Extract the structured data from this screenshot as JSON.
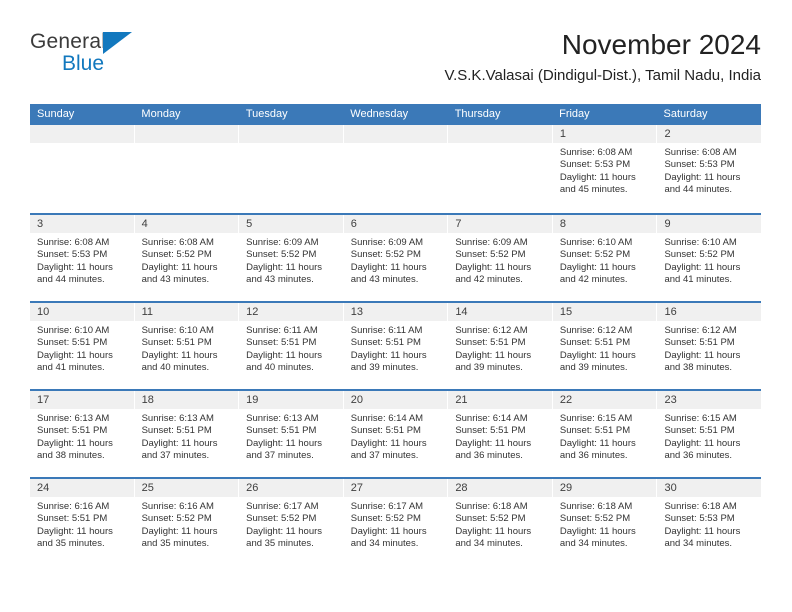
{
  "logo": {
    "word_top": "General",
    "word_bottom": "Blue",
    "triangle_icon": "triangle-icon",
    "blue": "#1278be"
  },
  "header": {
    "month_title": "November 2024",
    "location": "V.S.K.Valasai (Dindigul-Dist.), Tamil Nadu, India"
  },
  "colors": {
    "header_blue": "#3b79b8",
    "cell_header_gray": "#f0f0f0",
    "text": "#333333"
  },
  "weekdays": [
    "Sunday",
    "Monday",
    "Tuesday",
    "Wednesday",
    "Thursday",
    "Friday",
    "Saturday"
  ],
  "labels": {
    "sunrise": "Sunrise:",
    "sunset": "Sunset:",
    "daylight": "Daylight:"
  },
  "weeks": [
    [
      {
        "day": "",
        "empty": true
      },
      {
        "day": "",
        "empty": true
      },
      {
        "day": "",
        "empty": true
      },
      {
        "day": "",
        "empty": true
      },
      {
        "day": "",
        "empty": true
      },
      {
        "day": "1",
        "sunrise": "Sunrise: 6:08 AM",
        "sunset": "Sunset: 5:53 PM",
        "daylight": "Daylight: 11 hours and 45 minutes."
      },
      {
        "day": "2",
        "sunrise": "Sunrise: 6:08 AM",
        "sunset": "Sunset: 5:53 PM",
        "daylight": "Daylight: 11 hours and 44 minutes."
      }
    ],
    [
      {
        "day": "3",
        "sunrise": "Sunrise: 6:08 AM",
        "sunset": "Sunset: 5:53 PM",
        "daylight": "Daylight: 11 hours and 44 minutes."
      },
      {
        "day": "4",
        "sunrise": "Sunrise: 6:08 AM",
        "sunset": "Sunset: 5:52 PM",
        "daylight": "Daylight: 11 hours and 43 minutes."
      },
      {
        "day": "5",
        "sunrise": "Sunrise: 6:09 AM",
        "sunset": "Sunset: 5:52 PM",
        "daylight": "Daylight: 11 hours and 43 minutes."
      },
      {
        "day": "6",
        "sunrise": "Sunrise: 6:09 AM",
        "sunset": "Sunset: 5:52 PM",
        "daylight": "Daylight: 11 hours and 43 minutes."
      },
      {
        "day": "7",
        "sunrise": "Sunrise: 6:09 AM",
        "sunset": "Sunset: 5:52 PM",
        "daylight": "Daylight: 11 hours and 42 minutes."
      },
      {
        "day": "8",
        "sunrise": "Sunrise: 6:10 AM",
        "sunset": "Sunset: 5:52 PM",
        "daylight": "Daylight: 11 hours and 42 minutes."
      },
      {
        "day": "9",
        "sunrise": "Sunrise: 6:10 AM",
        "sunset": "Sunset: 5:52 PM",
        "daylight": "Daylight: 11 hours and 41 minutes."
      }
    ],
    [
      {
        "day": "10",
        "sunrise": "Sunrise: 6:10 AM",
        "sunset": "Sunset: 5:51 PM",
        "daylight": "Daylight: 11 hours and 41 minutes."
      },
      {
        "day": "11",
        "sunrise": "Sunrise: 6:10 AM",
        "sunset": "Sunset: 5:51 PM",
        "daylight": "Daylight: 11 hours and 40 minutes."
      },
      {
        "day": "12",
        "sunrise": "Sunrise: 6:11 AM",
        "sunset": "Sunset: 5:51 PM",
        "daylight": "Daylight: 11 hours and 40 minutes."
      },
      {
        "day": "13",
        "sunrise": "Sunrise: 6:11 AM",
        "sunset": "Sunset: 5:51 PM",
        "daylight": "Daylight: 11 hours and 39 minutes."
      },
      {
        "day": "14",
        "sunrise": "Sunrise: 6:12 AM",
        "sunset": "Sunset: 5:51 PM",
        "daylight": "Daylight: 11 hours and 39 minutes."
      },
      {
        "day": "15",
        "sunrise": "Sunrise: 6:12 AM",
        "sunset": "Sunset: 5:51 PM",
        "daylight": "Daylight: 11 hours and 39 minutes."
      },
      {
        "day": "16",
        "sunrise": "Sunrise: 6:12 AM",
        "sunset": "Sunset: 5:51 PM",
        "daylight": "Daylight: 11 hours and 38 minutes."
      }
    ],
    [
      {
        "day": "17",
        "sunrise": "Sunrise: 6:13 AM",
        "sunset": "Sunset: 5:51 PM",
        "daylight": "Daylight: 11 hours and 38 minutes."
      },
      {
        "day": "18",
        "sunrise": "Sunrise: 6:13 AM",
        "sunset": "Sunset: 5:51 PM",
        "daylight": "Daylight: 11 hours and 37 minutes."
      },
      {
        "day": "19",
        "sunrise": "Sunrise: 6:13 AM",
        "sunset": "Sunset: 5:51 PM",
        "daylight": "Daylight: 11 hours and 37 minutes."
      },
      {
        "day": "20",
        "sunrise": "Sunrise: 6:14 AM",
        "sunset": "Sunset: 5:51 PM",
        "daylight": "Daylight: 11 hours and 37 minutes."
      },
      {
        "day": "21",
        "sunrise": "Sunrise: 6:14 AM",
        "sunset": "Sunset: 5:51 PM",
        "daylight": "Daylight: 11 hours and 36 minutes."
      },
      {
        "day": "22",
        "sunrise": "Sunrise: 6:15 AM",
        "sunset": "Sunset: 5:51 PM",
        "daylight": "Daylight: 11 hours and 36 minutes."
      },
      {
        "day": "23",
        "sunrise": "Sunrise: 6:15 AM",
        "sunset": "Sunset: 5:51 PM",
        "daylight": "Daylight: 11 hours and 36 minutes."
      }
    ],
    [
      {
        "day": "24",
        "sunrise": "Sunrise: 6:16 AM",
        "sunset": "Sunset: 5:51 PM",
        "daylight": "Daylight: 11 hours and 35 minutes."
      },
      {
        "day": "25",
        "sunrise": "Sunrise: 6:16 AM",
        "sunset": "Sunset: 5:52 PM",
        "daylight": "Daylight: 11 hours and 35 minutes."
      },
      {
        "day": "26",
        "sunrise": "Sunrise: 6:17 AM",
        "sunset": "Sunset: 5:52 PM",
        "daylight": "Daylight: 11 hours and 35 minutes."
      },
      {
        "day": "27",
        "sunrise": "Sunrise: 6:17 AM",
        "sunset": "Sunset: 5:52 PM",
        "daylight": "Daylight: 11 hours and 34 minutes."
      },
      {
        "day": "28",
        "sunrise": "Sunrise: 6:18 AM",
        "sunset": "Sunset: 5:52 PM",
        "daylight": "Daylight: 11 hours and 34 minutes."
      },
      {
        "day": "29",
        "sunrise": "Sunrise: 6:18 AM",
        "sunset": "Sunset: 5:52 PM",
        "daylight": "Daylight: 11 hours and 34 minutes."
      },
      {
        "day": "30",
        "sunrise": "Sunrise: 6:18 AM",
        "sunset": "Sunset: 5:53 PM",
        "daylight": "Daylight: 11 hours and 34 minutes."
      }
    ]
  ]
}
